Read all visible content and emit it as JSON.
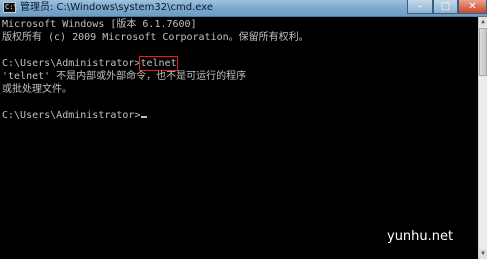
{
  "window": {
    "title": "管理员: C:\\Windows\\system32\\cmd.exe",
    "icon": "cmd-icon",
    "icon_text": "C:\\",
    "min_label": "–",
    "max_label": "□",
    "close_label": "✕"
  },
  "console": {
    "line1": "Microsoft Windows [版本 6.1.7600]",
    "line2": "版权所有 (c) 2009 Microsoft Corporation。保留所有权利。",
    "prompt1": "C:\\Users\\Administrator>",
    "command": "telnet",
    "error1": "'telnet' 不是内部或外部命令，也不是可运行的程序",
    "error2": "或批处理文件。",
    "prompt2": "C:\\Users\\Administrator>"
  },
  "colors": {
    "console_bg": "#000000",
    "console_text": "#c0c0c0",
    "highlight_box": "#e02020"
  },
  "watermark": "yunhu.net"
}
